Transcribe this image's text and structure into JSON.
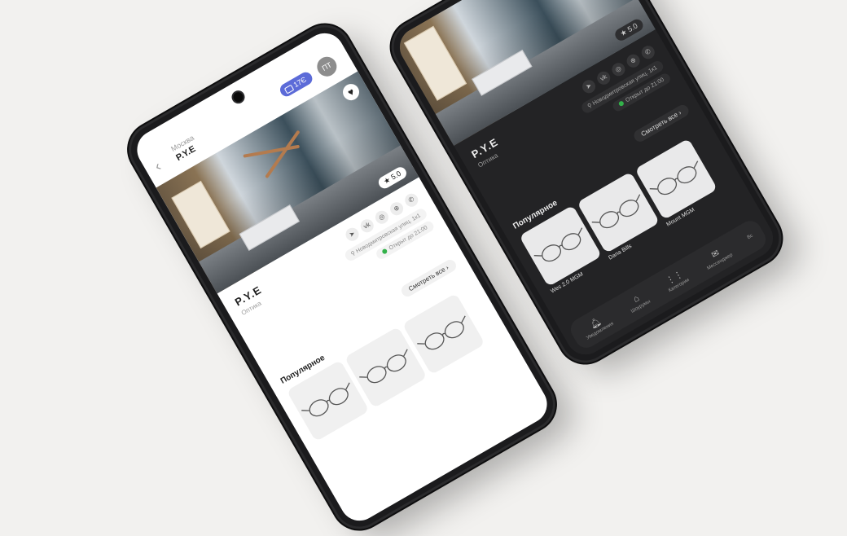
{
  "header": {
    "city": "Москва",
    "title": "P.Y.E",
    "points": "17Є",
    "avatar_initials": "ПТ"
  },
  "shop": {
    "rating": "★ 5.0",
    "name": "P.Y.E",
    "type": "Оптика",
    "address": "Новодмитровская улиц. 1к1",
    "open_status": "Открыт до 21:00",
    "social_icons": [
      "telegram-icon",
      "vk-icon",
      "instagram-icon",
      "globe-icon",
      "phone-icon"
    ]
  },
  "popular": {
    "heading": "Популярное",
    "see_all": "Смотреть все",
    "items": [
      {
        "name": "Wes 2.0 MGM"
      },
      {
        "name": "Dana Bills"
      },
      {
        "name": "Mount MGM"
      }
    ]
  },
  "tabbar": {
    "items": [
      {
        "label": "Уведомления",
        "icon": "bell-icon"
      },
      {
        "label": "Шоурумы",
        "icon": "storefront-icon"
      },
      {
        "label": "Категории",
        "icon": "grid-icon"
      },
      {
        "label": "Мессенджер",
        "icon": "envelope-icon"
      }
    ],
    "partial_label": "Вс"
  },
  "colors": {
    "background": "#f2f1ef",
    "accent_pill": "#5c6bd8",
    "open_dot": "#33b14a",
    "dark_screen": "#232325"
  }
}
